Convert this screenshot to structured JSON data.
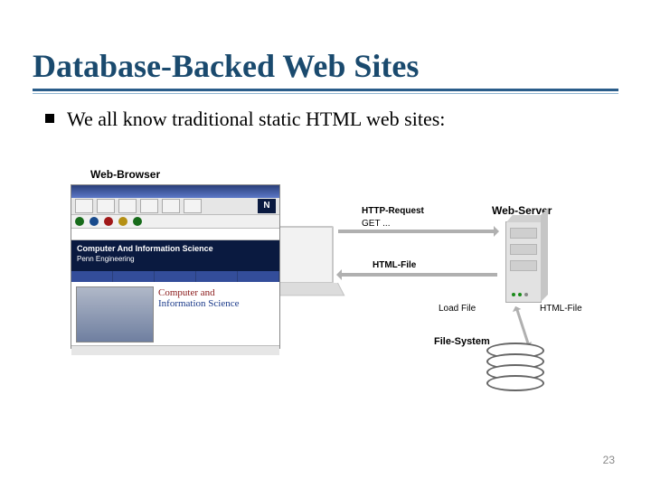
{
  "title": "Database-Backed Web Sites",
  "bullet": "We all know traditional static HTML web sites:",
  "labels": {
    "browser": "Web-Browser",
    "server": "Web-Server",
    "filesystem": "File-System",
    "http_req": "HTTP-Request",
    "http_get": "GET ...",
    "html_file_resp": "HTML-File",
    "load_file": "Load File",
    "html_file_disk": "HTML-File"
  },
  "browser_mock": {
    "n_badge": "N",
    "banner_line1": "Computer And Information Science",
    "banner_line2": "Penn Engineering",
    "content_title1": "Computer and",
    "content_title2": "Information Science"
  },
  "page_number": "23"
}
